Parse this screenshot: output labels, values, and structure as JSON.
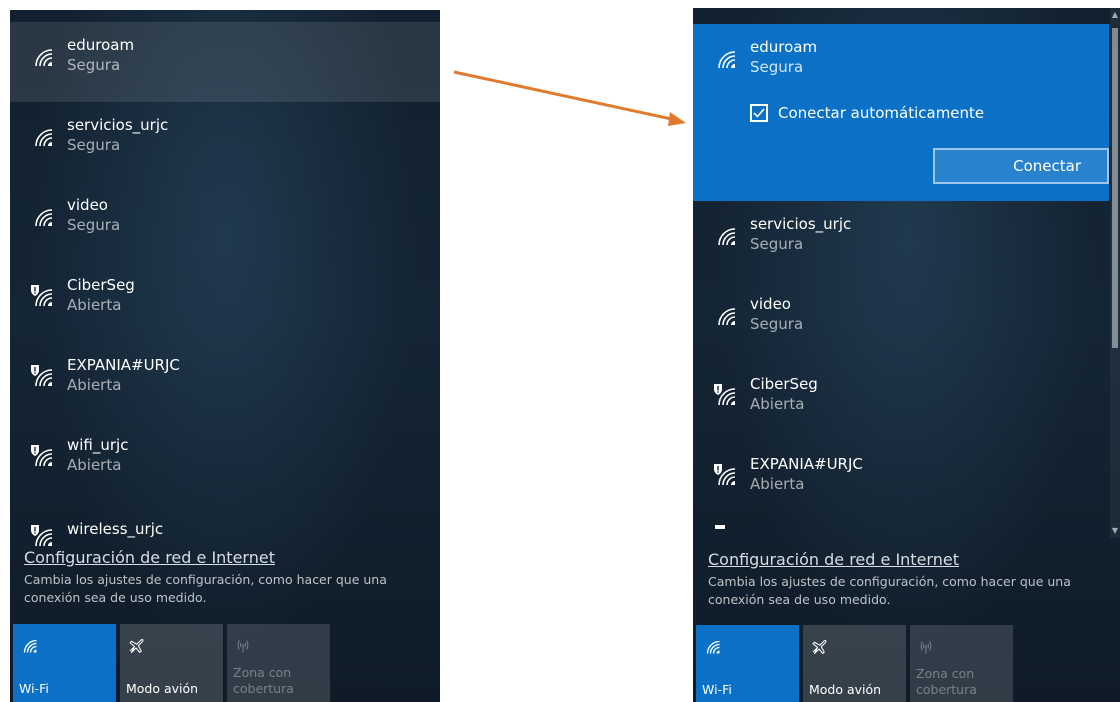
{
  "left": {
    "networks": [
      {
        "name": "eduroam",
        "status": "Segura",
        "secured": true
      },
      {
        "name": "servicios_urjc",
        "status": "Segura",
        "secured": true
      },
      {
        "name": "video",
        "status": "Segura",
        "secured": true
      },
      {
        "name": "CiberSeg",
        "status": "Abierta",
        "secured": false
      },
      {
        "name": "EXPANIA#URJC",
        "status": "Abierta",
        "secured": false
      },
      {
        "name": "wifi_urjc",
        "status": "Abierta",
        "secured": false
      },
      {
        "name": "wireless_urjc",
        "status": "",
        "secured": false
      }
    ],
    "settings": {
      "link": "Configuración de red e Internet",
      "desc": "Cambia los ajustes de configuración, como hacer que una conexión sea de uso medido."
    },
    "tiles": [
      {
        "label": "Wi-Fi",
        "icon": "wifi-icon",
        "state": "active"
      },
      {
        "label": "Modo avión",
        "icon": "airplane-icon",
        "state": "normal"
      },
      {
        "label": "Zona con cobertura",
        "icon": "hotspot-icon",
        "state": "disabled"
      }
    ]
  },
  "right": {
    "selected": {
      "name": "eduroam",
      "status": "Segura",
      "auto_connect_label": "Conectar automáticamente",
      "auto_connect_checked": true,
      "connect_label": "Conectar"
    },
    "networks": [
      {
        "name": "servicios_urjc",
        "status": "Segura",
        "secured": true
      },
      {
        "name": "video",
        "status": "Segura",
        "secured": true
      },
      {
        "name": "CiberSeg",
        "status": "Abierta",
        "secured": false
      },
      {
        "name": "EXPANIA#URJC",
        "status": "Abierta",
        "secured": false
      }
    ],
    "settings": {
      "link": "Configuración de red e Internet",
      "desc": "Cambia los ajustes de configuración, como hacer que una conexión sea de uso medido."
    },
    "tiles": [
      {
        "label": "Wi-Fi",
        "icon": "wifi-icon",
        "state": "active"
      },
      {
        "label": "Modo avión",
        "icon": "airplane-icon",
        "state": "normal"
      },
      {
        "label": "Zona con cobertura",
        "icon": "hotspot-icon",
        "state": "disabled"
      }
    ]
  },
  "colors": {
    "accent": "#0b71c7",
    "arrow": "#e07a2e",
    "panel_bg": "#142535"
  }
}
